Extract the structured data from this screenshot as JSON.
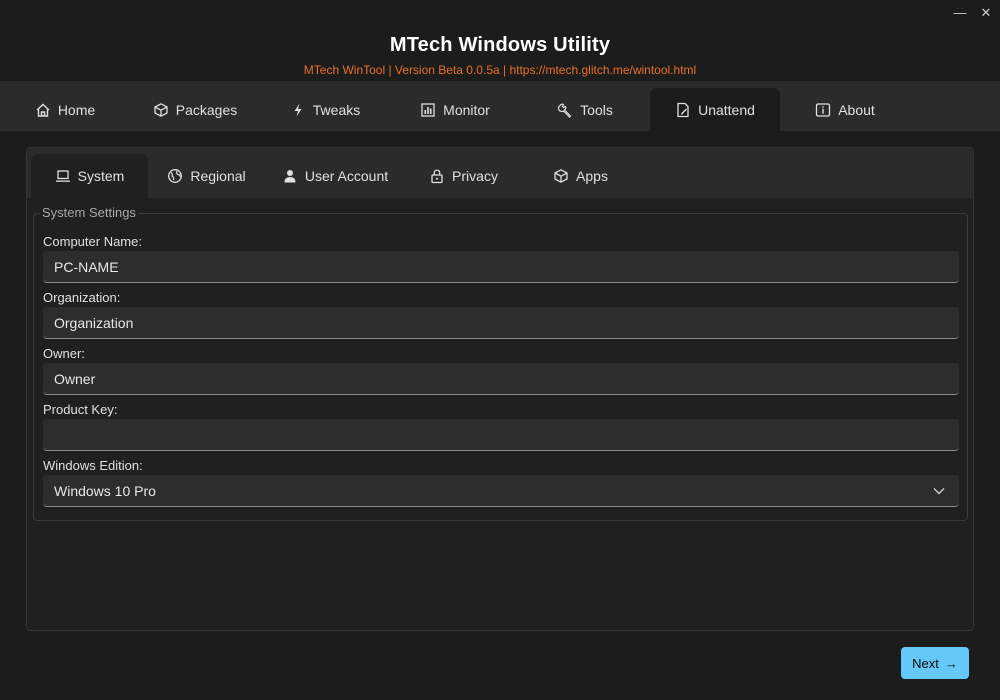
{
  "window": {
    "minimize_glyph": "—",
    "close_glyph": "✕"
  },
  "header": {
    "title": "MTech Windows Utility",
    "subtitle": "MTech WinTool | Version Beta 0.0.5a | https://mtech.glitch.me/wintool.html",
    "subtitle_color": "#e8702a"
  },
  "main_tabs": [
    {
      "label": "Home",
      "icon": "home-icon"
    },
    {
      "label": "Packages",
      "icon": "package-icon"
    },
    {
      "label": "Tweaks",
      "icon": "lightning-icon"
    },
    {
      "label": "Monitor",
      "icon": "chart-icon"
    },
    {
      "label": "Tools",
      "icon": "wrench-icon"
    },
    {
      "label": "Unattend",
      "icon": "document-edit-icon",
      "active": true
    },
    {
      "label": "About",
      "icon": "info-icon"
    }
  ],
  "sub_tabs": [
    {
      "label": "System",
      "icon": "laptop-icon",
      "active": true
    },
    {
      "label": "Regional",
      "icon": "globe-icon"
    },
    {
      "label": "User Account",
      "icon": "user-icon"
    },
    {
      "label": "Privacy",
      "icon": "lock-icon"
    },
    {
      "label": "Apps",
      "icon": "package-icon"
    }
  ],
  "system_settings": {
    "legend": "System Settings",
    "computer_name_label": "Computer Name:",
    "computer_name_value": "PC-NAME",
    "organization_label": "Organization:",
    "organization_value": "Organization",
    "owner_label": "Owner:",
    "owner_value": "Owner",
    "product_key_label": "Product Key:",
    "product_key_value": "",
    "windows_edition_label": "Windows Edition:",
    "windows_edition_value": "Windows 10 Pro"
  },
  "footer": {
    "next_label": "Next",
    "next_arrow": "→",
    "accent_color": "#64c8f8"
  }
}
